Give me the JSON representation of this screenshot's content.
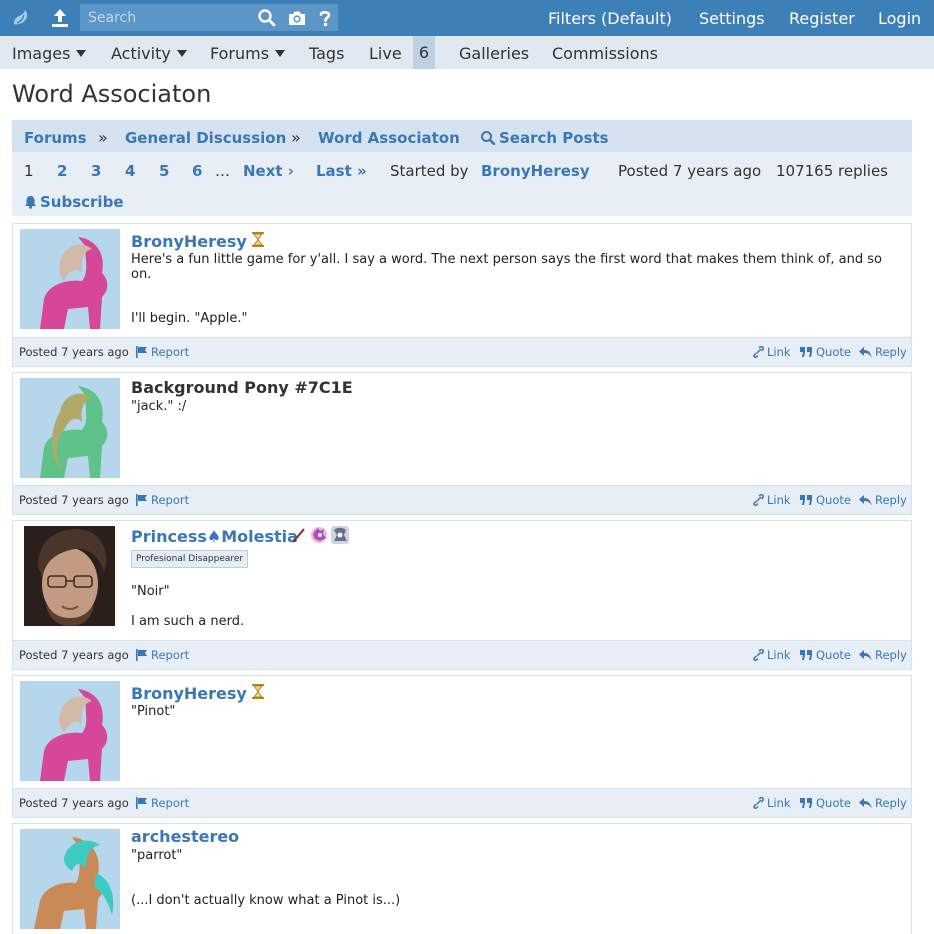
{
  "header": {
    "search_placeholder": "Search",
    "filters": "Filters (Default)",
    "settings": "Settings",
    "register": "Register",
    "login": "Login"
  },
  "nav": {
    "images": "Images",
    "activity": "Activity",
    "forums": "Forums",
    "tags": "Tags",
    "live": "Live",
    "live_count": "6",
    "galleries": "Galleries",
    "commissions": "Commissions"
  },
  "page_title": "Word Associaton",
  "breadcrumb": {
    "forums": "Forums",
    "sep": "»",
    "general": "General Discussion",
    "topic": "Word Associaton",
    "search_posts": "Search Posts"
  },
  "pagination": {
    "current": "1",
    "pages": [
      "2",
      "3",
      "4",
      "5",
      "6"
    ],
    "ellipsis": "…",
    "next": "Next ›",
    "last": "Last »",
    "started_by": "Started by",
    "starter": "BronyHeresy",
    "posted": "Posted 7 years ago",
    "replies": "107165 replies",
    "subscribe": "Subscribe"
  },
  "actions": {
    "posted": "Posted 7 years ago",
    "report": "Report",
    "link": "Link",
    "quote": "Quote",
    "reply": "Reply"
  },
  "posts": [
    {
      "author": "BronyHeresy",
      "lines": [
        "Here's a fun little game for y'all. I say a word. The next person says the first word that makes them think of, and so on.",
        "I'll begin. \"Apple.\""
      ],
      "avatar_colors": {
        "bg": "#b6d6ec",
        "body": "#d6479a",
        "mane": "#d2b9a8"
      }
    },
    {
      "author": "Background Pony #7C1E",
      "lines": [
        "\"jack.\" :/"
      ],
      "avatar_colors": {
        "bg": "#b6d6ec",
        "body": "#5ec28a",
        "mane": "#b0a96a"
      }
    },
    {
      "author": "Princess♠Molestia",
      "tag": "Profesional Disappearer",
      "lines": [
        "\"Noir\"",
        "I am such a nerd."
      ]
    },
    {
      "author": "BronyHeresy",
      "lines": [
        "\"Pinot\""
      ],
      "avatar_colors": {
        "bg": "#b6d6ec",
        "body": "#d6479a",
        "mane": "#d2b9a8"
      }
    },
    {
      "author": "archestereo",
      "lines": [
        "\"parrot\"",
        "(...I don't actually know what a Pinot is...)"
      ],
      "avatar_colors": {
        "bg": "#b6d6ec",
        "body": "#c98a55",
        "mane": "#3ec9c1"
      }
    }
  ]
}
